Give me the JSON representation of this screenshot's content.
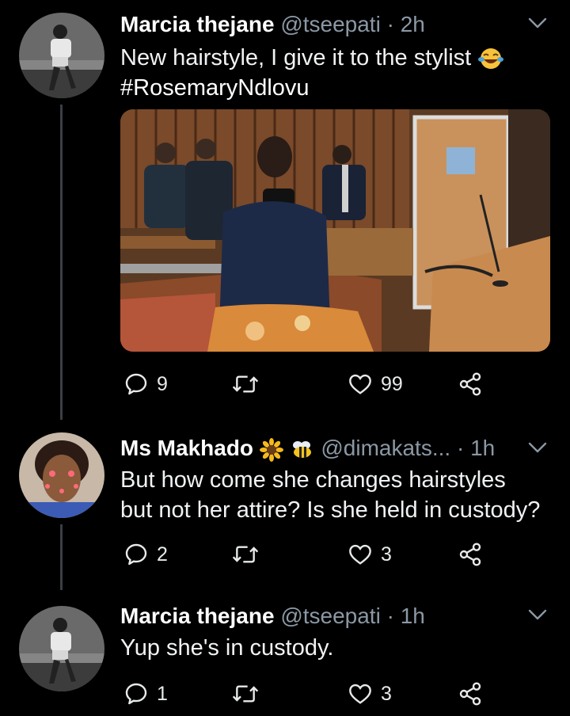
{
  "tweets": [
    {
      "name": "Marcia thejane",
      "handle": "@tseepati",
      "dot": "·",
      "time": "2h",
      "text": "New hairstyle, I give it to the stylist",
      "hashtag": "#RosemaryNdlovu",
      "replies": "9",
      "retweets": "",
      "likes": "99"
    },
    {
      "name": "Ms Makhado",
      "handle": "@dimakats...",
      "dot": "·",
      "time": "1h",
      "text_line1": "But how come she changes hairstyles",
      "text_line2": "but not her attire? Is she held in custody?",
      "replies": "2",
      "retweets": "",
      "likes": "3"
    },
    {
      "name": "Marcia thejane",
      "handle": "@tseepati",
      "dot": "·",
      "time": "1h",
      "text": "Yup she's in custody.",
      "replies": "1",
      "retweets": "",
      "likes": "3"
    }
  ],
  "icons": {
    "reply": "reply-icon",
    "retweet": "retweet-icon",
    "like": "heart-icon",
    "share": "share-icon",
    "more": "chevron-down-icon",
    "laugh": "tears-of-joy-emoji",
    "sunflower": "sunflower-emoji",
    "bee": "bee-emoji"
  },
  "colors": {
    "background": "#000000",
    "text": "#e7e9ea",
    "secondary": "#8b98a5",
    "thread_line": "#3a3f44"
  }
}
